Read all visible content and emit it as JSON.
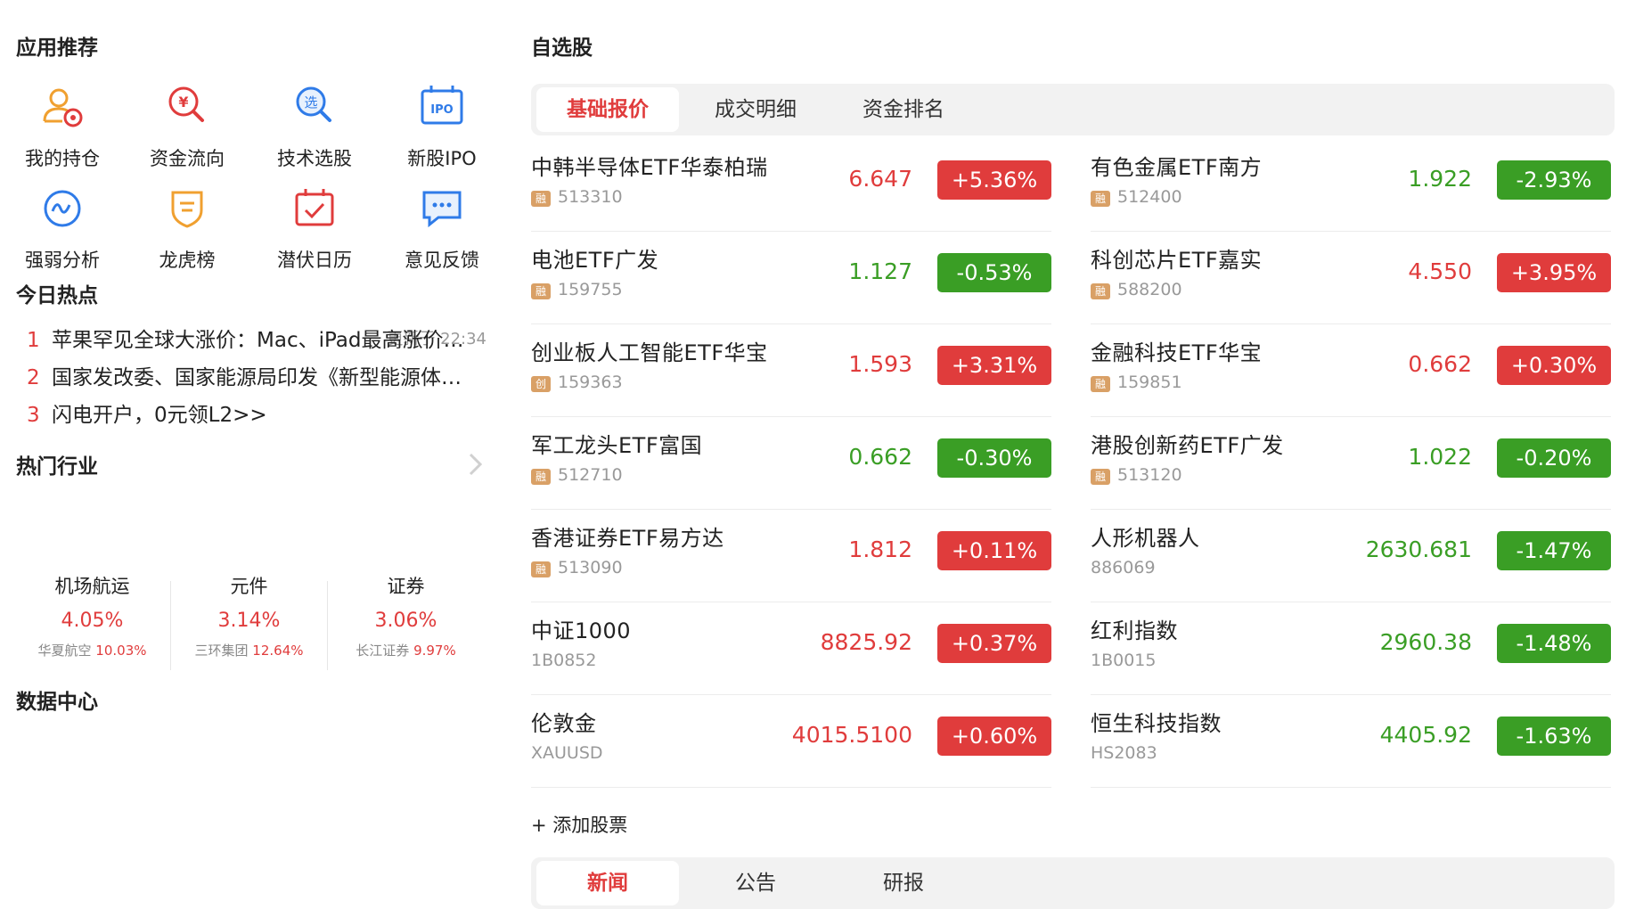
{
  "left": {
    "apps_title": "应用推荐",
    "apps": [
      {
        "label": "我的持仓",
        "icon": "user-position-icon"
      },
      {
        "label": "资金流向",
        "icon": "money-search-icon"
      },
      {
        "label": "技术选股",
        "icon": "stock-select-icon"
      },
      {
        "label": "新股IPO",
        "icon": "ipo-icon"
      },
      {
        "label": "强弱分析",
        "icon": "wave-analysis-icon"
      },
      {
        "label": "龙虎榜",
        "icon": "shield-rank-icon"
      },
      {
        "label": "潜伏日历",
        "icon": "calendar-check-icon"
      },
      {
        "label": "意见反馈",
        "icon": "feedback-chat-icon"
      }
    ],
    "hot_title": "今日热点",
    "hot_updated": "更新于 22:34",
    "hot_news": [
      {
        "no": "1",
        "text": "苹果罕见全球大涨价：Mac、iPad最高涨价…"
      },
      {
        "no": "2",
        "text": "国家发改委、国家能源局印发《新型能源体系…"
      },
      {
        "no": "3",
        "text": "闪电开户，0元领L2>>"
      }
    ],
    "industry_title": "热门行业",
    "industries": [
      {
        "name": "机场航运",
        "pct": "4.05%",
        "stock": "华夏航空",
        "stock_pct": "10.03%"
      },
      {
        "name": "元件",
        "pct": "3.14%",
        "stock": "三环集团",
        "stock_pct": "12.64%"
      },
      {
        "name": "证券",
        "pct": "3.06%",
        "stock": "长江证券",
        "stock_pct": "9.97%"
      }
    ],
    "data_center_title": "数据中心"
  },
  "right": {
    "title": "自选股",
    "tabs": [
      "基础报价",
      "成交明细",
      "资金排名"
    ],
    "quotes_left": [
      {
        "name": "中韩半导体ETF华泰柏瑞",
        "badge": "融",
        "code": "513310",
        "price": "6.647",
        "change": "+5.36%",
        "dir": "up"
      },
      {
        "name": "电池ETF广发",
        "badge": "融",
        "code": "159755",
        "price": "1.127",
        "change": "-0.53%",
        "dir": "dn"
      },
      {
        "name": "创业板人工智能ETF华宝",
        "badge": "创",
        "code": "159363",
        "price": "1.593",
        "change": "+3.31%",
        "dir": "up"
      },
      {
        "name": "军工龙头ETF富国",
        "badge": "融",
        "code": "512710",
        "price": "0.662",
        "change": "-0.30%",
        "dir": "dn"
      },
      {
        "name": "香港证券ETF易方达",
        "badge": "融",
        "code": "513090",
        "price": "1.812",
        "change": "+0.11%",
        "dir": "up"
      },
      {
        "name": "中证1000",
        "badge": "",
        "code": "1B0852",
        "price": "8825.92",
        "change": "+0.37%",
        "dir": "up"
      },
      {
        "name": "伦敦金",
        "badge": "",
        "code": "XAUUSD",
        "price": "4015.5100",
        "change": "+0.60%",
        "dir": "up"
      }
    ],
    "quotes_right": [
      {
        "name": "有色金属ETF南方",
        "badge": "融",
        "code": "512400",
        "price": "1.922",
        "change": "-2.93%",
        "dir": "dn"
      },
      {
        "name": "科创芯片ETF嘉实",
        "badge": "融",
        "code": "588200",
        "price": "4.550",
        "change": "+3.95%",
        "dir": "up"
      },
      {
        "name": "金融科技ETF华宝",
        "badge": "融",
        "code": "159851",
        "price": "0.662",
        "change": "+0.30%",
        "dir": "up"
      },
      {
        "name": "港股创新药ETF广发",
        "badge": "融",
        "code": "513120",
        "price": "1.022",
        "change": "-0.20%",
        "dir": "dn"
      },
      {
        "name": "人形机器人",
        "badge": "",
        "code": "886069",
        "price": "2630.681",
        "change": "-1.47%",
        "dir": "dn"
      },
      {
        "name": "红利指数",
        "badge": "",
        "code": "1B0015",
        "price": "2960.38",
        "change": "-1.48%",
        "dir": "dn"
      },
      {
        "name": "恒生科技指数",
        "badge": "",
        "code": "HS2083",
        "price": "4405.92",
        "change": "-1.63%",
        "dir": "dn"
      }
    ],
    "add_label": "+ 添加股票",
    "bottom_tabs": [
      "新闻",
      "公告",
      "研报"
    ]
  },
  "colors": {
    "up": "#e03c3c",
    "down": "#3a9e25",
    "accent": "#e03c3c"
  }
}
